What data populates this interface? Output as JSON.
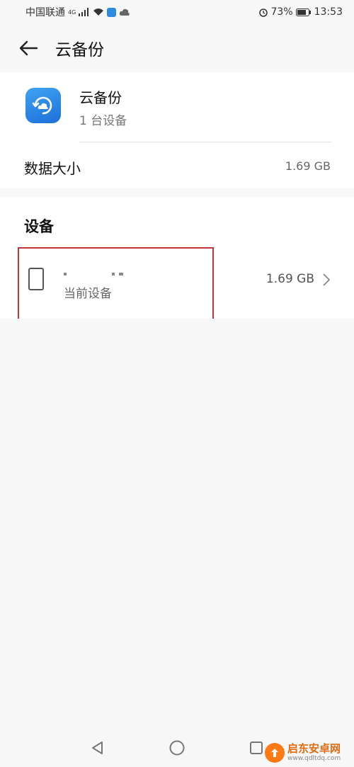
{
  "status_bar": {
    "carrier": "中国联通",
    "network": "4G",
    "battery": "73%",
    "time": "13:53"
  },
  "header": {
    "title": "云备份",
    "back_icon": "arrow-left-icon"
  },
  "app": {
    "name": "云备份",
    "device_count": "1 台设备",
    "data_size_label": "数据大小",
    "data_size_value": "1.69 GB",
    "accent": "#2f86e8"
  },
  "devices": {
    "section_title": "设备",
    "items": [
      {
        "subtitle": "当前设备",
        "size": "1.69 GB"
      }
    ]
  },
  "watermark": {
    "title": "启东安卓网",
    "url": "www.qdltdq.com"
  },
  "colors": {
    "highlight": "#c0343c",
    "background": "#f7f7f7"
  }
}
